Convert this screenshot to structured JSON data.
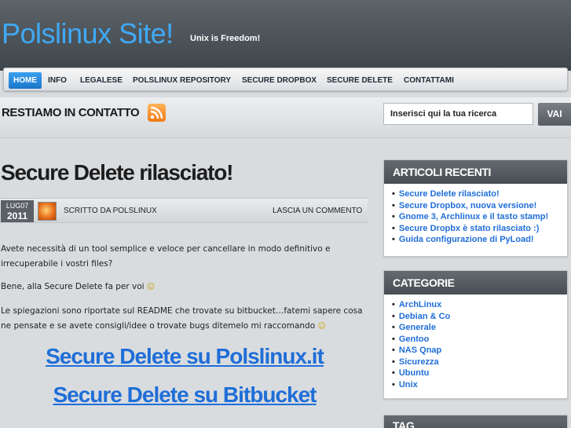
{
  "header": {
    "site_title": "Polslinux Site!",
    "tagline": "Unix is Freedom!"
  },
  "nav": {
    "items": [
      "HOME",
      "INFO",
      "LEGALESE",
      "POLSLINUX REPOSITORY",
      "SECURE DROPBOX",
      "SECURE DELETE",
      "CONTATTAMI"
    ],
    "active": "HOME"
  },
  "contact": {
    "title": "RESTIAMO IN CONTATTO",
    "icon": "rss-icon"
  },
  "search": {
    "placeholder": "Inserisci qui la tua ricerca",
    "button_label": "VAI"
  },
  "post": {
    "title": "Secure Delete rilasciato!",
    "date_month": "LUG07",
    "date_year": "2011",
    "written_by": "SCRITTO DA POLSLINUX",
    "comment_link": "LASCIA UN COMMENTO",
    "paragraph1": "Avete necessità di un tool semplice e veloce per cancellare in modo definitivo e irrecuperabile i vostri files?",
    "paragraph2": "Bene, alla Secure Delete fa per voi",
    "paragraph3": "Le spiegazioni sono riportate sul README che trovate su bitbucket…fatemi sapere cosa ne pensate e se avete consigli/idee o trovate bugs ditemelo mi raccomando",
    "smiley": "☺",
    "link1": "Secure Delete su Polslinux.it",
    "link2": "Secure Delete su Bitbucket"
  },
  "sidebar": {
    "recent": {
      "title": "ARTICOLI RECENTI",
      "items": [
        "Secure Delete rilasciato!",
        "Secure Dropbox, nuova versione!",
        "Gnome 3, Archlinux e il tasto stamp!",
        "Secure Dropbx è stato rilasciato :)",
        "Guida configurazione di PyLoad!"
      ]
    },
    "categories": {
      "title": "CATEGORIE",
      "items": [
        "ArchLinux",
        "Debian & Co",
        "Generale",
        "Gentoo",
        "NAS Qnap",
        "Sicurezza",
        "Ubuntu",
        "Unix"
      ]
    },
    "tag": {
      "title": "TAG"
    }
  },
  "colors": {
    "accent": "#3fa9f5",
    "link": "#1f6ed8",
    "nav_active": "#2a8ce0",
    "rss": "#f07a12"
  }
}
